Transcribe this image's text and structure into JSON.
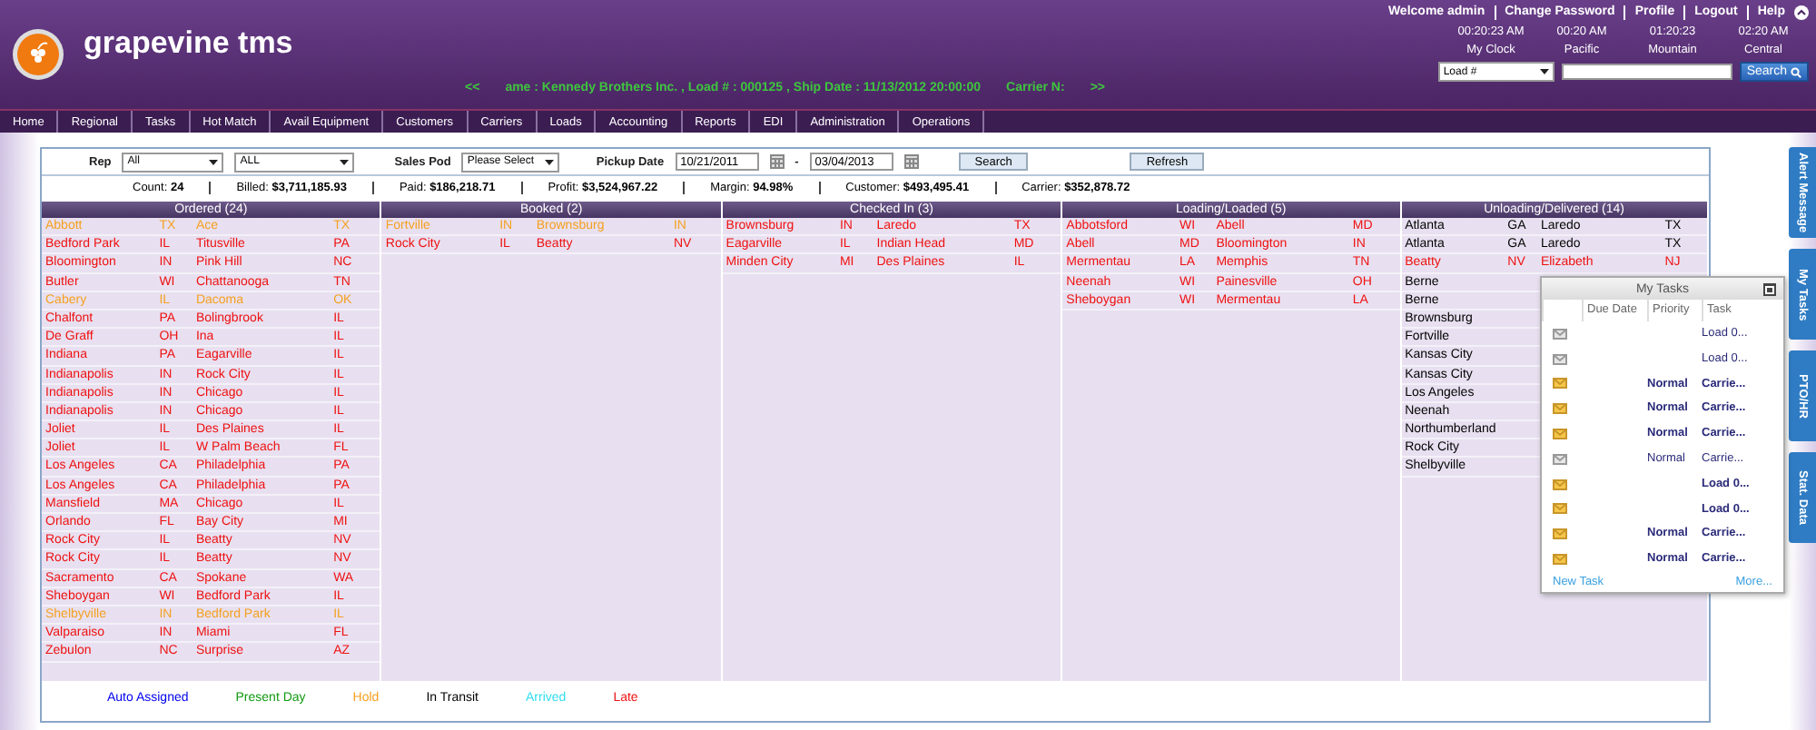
{
  "app": {
    "title": "grapevine tms"
  },
  "user_links": [
    "Welcome admin",
    "Change Password",
    "Profile",
    "Logout",
    "Help"
  ],
  "clocks": [
    {
      "time": "00:20:23 AM",
      "label": "My Clock"
    },
    {
      "time": "00:20 AM",
      "label": "Pacific"
    },
    {
      "time": "01:20:23",
      "label": "Mountain"
    },
    {
      "time": "02:20 AM",
      "label": "Central"
    }
  ],
  "ticker": {
    "prev": "<<",
    "text": "ame : Kennedy Brothers Inc. , Load # : 000125 , Ship Date : 11/13/2012 20:00:00",
    "tail": "Carrier N:",
    "next": ">>"
  },
  "search": {
    "field": "Load #",
    "button": "Search"
  },
  "nav": [
    "Home",
    "Regional",
    "Tasks",
    "Hot Match",
    "Avail Equipment",
    "Customers",
    "Carriers",
    "Loads",
    "Accounting",
    "Reports",
    "EDI",
    "Administration",
    "Operations"
  ],
  "filters": {
    "rep_label": "Rep",
    "rep": "All",
    "rep_2": "ALL",
    "pod_label": "Sales Pod",
    "pod": "Please Select",
    "date_label": "Pickup Date",
    "date_from": "10/21/2011",
    "date_sep": "-",
    "date_to": "03/04/2013",
    "search": "Search",
    "refresh": "Refresh"
  },
  "summary": [
    "Count: **24**",
    "Billed: **$3,711,185.93**",
    "Paid: **$186,218.71**",
    "Profit: **$3,524,967.22**",
    "Margin: **94.98%**",
    "Customer: **$493,495.41**",
    "Carrier: **$352,878.72**"
  ],
  "board": [
    {
      "title": "Ordered (24)",
      "rows": [
        {
          "origin": "Abbott",
          "os": "TX",
          "dest": "Ace",
          "ds": "TX",
          "color": "#f5a020"
        },
        {
          "origin": "Bedford Park",
          "os": "IL",
          "dest": "Titusville",
          "ds": "PA",
          "color": "#ee1111"
        },
        {
          "origin": "Bloomington",
          "os": "IN",
          "dest": "Pink Hill",
          "ds": "NC",
          "color": "#ee1111"
        },
        {
          "origin": "Butler",
          "os": "WI",
          "dest": "Chattanooga",
          "ds": "TN",
          "color": "#ee1111"
        },
        {
          "origin": "Cabery",
          "os": "IL",
          "dest": "Dacoma",
          "ds": "OK",
          "color": "#f5a020"
        },
        {
          "origin": "Chalfont",
          "os": "PA",
          "dest": "Bolingbrook",
          "ds": "IL",
          "color": "#ee1111"
        },
        {
          "origin": "De Graff",
          "os": "OH",
          "dest": "Ina",
          "ds": "IL",
          "color": "#ee1111"
        },
        {
          "origin": "Indiana",
          "os": "PA",
          "dest": "Eagarville",
          "ds": "IL",
          "color": "#ee1111"
        },
        {
          "origin": "Indianapolis",
          "os": "IN",
          "dest": "Rock City",
          "ds": "IL",
          "color": "#ee1111"
        },
        {
          "origin": "Indianapolis",
          "os": "IN",
          "dest": "Chicago",
          "ds": "IL",
          "color": "#ee1111"
        },
        {
          "origin": "Indianapolis",
          "os": "IN",
          "dest": "Chicago",
          "ds": "IL",
          "color": "#ee1111"
        },
        {
          "origin": "Joliet",
          "os": "IL",
          "dest": "Des Plaines",
          "ds": "IL",
          "color": "#ee1111"
        },
        {
          "origin": "Joliet",
          "os": "IL",
          "dest": "W Palm Beach",
          "ds": "FL",
          "color": "#ee1111"
        },
        {
          "origin": "Los Angeles",
          "os": "CA",
          "dest": "Philadelphia",
          "ds": "PA",
          "color": "#ee1111"
        },
        {
          "origin": "Los Angeles",
          "os": "CA",
          "dest": "Philadelphia",
          "ds": "PA",
          "color": "#ee1111"
        },
        {
          "origin": "Mansfield",
          "os": "MA",
          "dest": "Chicago",
          "ds": "IL",
          "color": "#ee1111"
        },
        {
          "origin": "Orlando",
          "os": "FL",
          "dest": "Bay City",
          "ds": "MI",
          "color": "#ee1111"
        },
        {
          "origin": "Rock City",
          "os": "IL",
          "dest": "Beatty",
          "ds": "NV",
          "color": "#ee1111"
        },
        {
          "origin": "Rock City",
          "os": "IL",
          "dest": "Beatty",
          "ds": "NV",
          "color": "#ee1111"
        },
        {
          "origin": "Sacramento",
          "os": "CA",
          "dest": "Spokane",
          "ds": "WA",
          "color": "#ee1111"
        },
        {
          "origin": "Sheboygan",
          "os": "WI",
          "dest": "Bedford Park",
          "ds": "IL",
          "color": "#ee1111"
        },
        {
          "origin": "Shelbyville",
          "os": "IN",
          "dest": "Bedford Park",
          "ds": "IL",
          "color": "#f5a020"
        },
        {
          "origin": "Valparaiso",
          "os": "IN",
          "dest": "Miami",
          "ds": "FL",
          "color": "#ee1111"
        },
        {
          "origin": "Zebulon",
          "os": "NC",
          "dest": "Surprise",
          "ds": "AZ",
          "color": "#ee1111"
        }
      ]
    },
    {
      "title": "Booked (2)",
      "rows": [
        {
          "origin": "Fortville",
          "os": "IN",
          "dest": "Brownsburg",
          "ds": "IN",
          "color": "#f5a020"
        },
        {
          "origin": "Rock City",
          "os": "IL",
          "dest": "Beatty",
          "ds": "NV",
          "color": "#ee1111"
        }
      ]
    },
    {
      "title": "Checked In (3)",
      "rows": [
        {
          "origin": "Brownsburg",
          "os": "IN",
          "dest": "Laredo",
          "ds": "TX",
          "color": "#ee1111"
        },
        {
          "origin": "Eagarville",
          "os": "IL",
          "dest": "Indian Head",
          "ds": "MD",
          "color": "#ee1111"
        },
        {
          "origin": "Minden City",
          "os": "MI",
          "dest": "Des Plaines",
          "ds": "IL",
          "color": "#ee1111"
        }
      ]
    },
    {
      "title": "Loading/Loaded (5)",
      "rows": [
        {
          "origin": "Abbotsford",
          "os": "WI",
          "dest": "Abell",
          "ds": "MD",
          "color": "#ee1111"
        },
        {
          "origin": "Abell",
          "os": "MD",
          "dest": "Bloomington",
          "ds": "IN",
          "color": "#ee1111"
        },
        {
          "origin": "Mermentau",
          "os": "LA",
          "dest": "Memphis",
          "ds": "TN",
          "color": "#ee1111"
        },
        {
          "origin": "Neenah",
          "os": "WI",
          "dest": "Painesville",
          "ds": "OH",
          "color": "#ee1111"
        },
        {
          "origin": "Sheboygan",
          "os": "WI",
          "dest": "Mermentau",
          "ds": "LA",
          "color": "#ee1111"
        }
      ]
    },
    {
      "title": "Unloading/Delivered (14)",
      "rows": [
        {
          "origin": "Atlanta",
          "os": "GA",
          "dest": "Laredo",
          "ds": "TX",
          "color": "#000000"
        },
        {
          "origin": "Atlanta",
          "os": "GA",
          "dest": "Laredo",
          "ds": "TX",
          "color": "#000000"
        },
        {
          "origin": "Beatty",
          "os": "NV",
          "dest": "Elizabeth",
          "ds": "NJ",
          "color": "#ee1111"
        },
        {
          "origin": "Berne",
          "color": "#000000"
        },
        {
          "origin": "Berne",
          "color": "#000000"
        },
        {
          "origin": "Brownsburg",
          "color": "#000000"
        },
        {
          "origin": "Fortville",
          "color": "#000000"
        },
        {
          "origin": "Kansas City",
          "color": "#000000"
        },
        {
          "origin": "Kansas City",
          "color": "#000000"
        },
        {
          "origin": "Los Angeles",
          "color": "#000000"
        },
        {
          "origin": "Neenah",
          "color": "#000000"
        },
        {
          "origin": "Northumberland",
          "color": "#000000"
        },
        {
          "origin": "Rock City",
          "color": "#000000"
        },
        {
          "origin": "Shelbyville",
          "color": "#000000"
        }
      ]
    }
  ],
  "legend": [
    {
      "label": "Auto Assigned",
      "color": "#0000ee"
    },
    {
      "label": "Present Day",
      "color": "#119911"
    },
    {
      "label": "Hold",
      "color": "#f5a020"
    },
    {
      "label": "In Transit",
      "color": "#000000"
    },
    {
      "label": "Arrived",
      "color": "#33ddee"
    },
    {
      "label": "Late",
      "color": "#ee1111"
    }
  ],
  "side_tabs": [
    "Alert Message",
    "My Tasks",
    "PTO/HR",
    "Stat. Data"
  ],
  "tasks": {
    "title": "My Tasks",
    "columns": [
      "Due Date",
      "Priority",
      "Task"
    ],
    "rows": [
      {
        "unread": false,
        "task": "Load 0..."
      },
      {
        "unread": false,
        "task": "Load 0..."
      },
      {
        "unread": true,
        "priority": "Normal",
        "task": "Carrie..."
      },
      {
        "unread": true,
        "priority": "Normal",
        "task": "Carrie..."
      },
      {
        "unread": true,
        "priority": "Normal",
        "task": "Carrie..."
      },
      {
        "unread": false,
        "priority": "Normal",
        "task": "Carrie..."
      },
      {
        "unread": true,
        "task": "Load 0..."
      },
      {
        "unread": true,
        "task": "Load 0..."
      },
      {
        "unread": true,
        "priority": "Normal",
        "task": "Carrie..."
      },
      {
        "unread": true,
        "priority": "Normal",
        "task": "Carrie..."
      }
    ],
    "new_task": "New Task",
    "more": "More..."
  }
}
